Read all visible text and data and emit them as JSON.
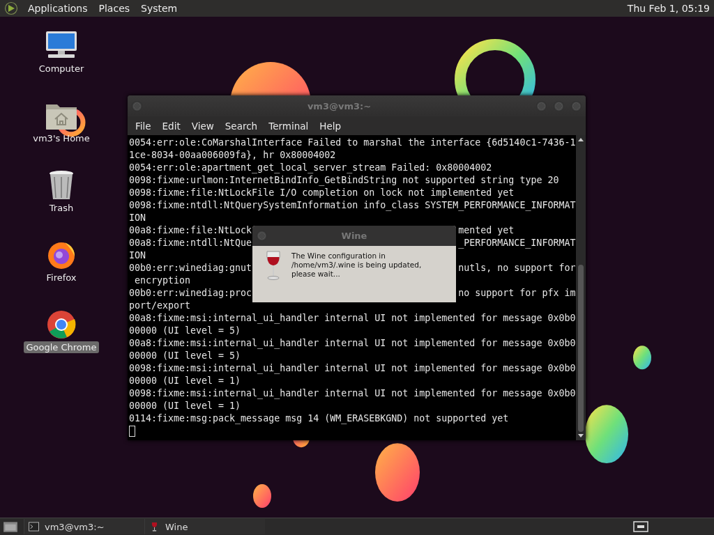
{
  "top_panel": {
    "menus": [
      "Applications",
      "Places",
      "System"
    ],
    "clock": "Thu Feb  1, 05:19"
  },
  "desktop_icons": [
    {
      "kind": "computer",
      "label": "Computer",
      "selected": false
    },
    {
      "kind": "home",
      "label": "vm3's Home",
      "selected": false
    },
    {
      "kind": "trash",
      "label": "Trash",
      "selected": false
    },
    {
      "kind": "firefox",
      "label": "Firefox",
      "selected": false
    },
    {
      "kind": "chrome",
      "label": "Google Chrome",
      "selected": true
    }
  ],
  "terminal": {
    "title": "vm3@vm3:~",
    "menus": [
      "File",
      "Edit",
      "View",
      "Search",
      "Terminal",
      "Help"
    ],
    "rows": [
      {
        "text": "0054:err:ole:CoMarshalInterface Failed to marshal the interface {6d5140c1-7436-1"
      },
      {
        "text": "1ce-8034-00aa006009fa}, hr 0x80004002"
      },
      {
        "text": "0054:err:ole:apartment_get_local_server_stream Failed: 0x80004002"
      },
      {
        "text": "0098:fixme:urlmon:InternetBindInfo_GetBindString not supported string type 20"
      },
      {
        "text": "0098:fixme:file:NtLockFile I/O completion on lock not implemented yet"
      },
      {
        "text": "0098:fixme:ntdll:NtQuerySystemInformation info_class SYSTEM_PERFORMANCE_INFORMAT"
      },
      {
        "text": "ION"
      },
      {
        "text": "00a8:fixme:file:NtLock",
        "right": "mented yet"
      },
      {
        "text": "00a8:fixme:ntdll:NtQue",
        "right": "_PERFORMANCE_INFORMAT"
      },
      {
        "text": "ION"
      },
      {
        "text": "00b0:err:winediag:gnut",
        "right": "nutls, no support for"
      },
      {
        "text": " encryption"
      },
      {
        "text": "00b0:err:winediag:proc",
        "right": "no support for pfx im"
      },
      {
        "text": "port/export"
      },
      {
        "text": "00a8:fixme:msi:internal_ui_handler internal UI not implemented for message 0x0b0"
      },
      {
        "text": "00000 (UI level = 5)"
      },
      {
        "text": "00a8:fixme:msi:internal_ui_handler internal UI not implemented for message 0x0b0"
      },
      {
        "text": "00000 (UI level = 5)"
      },
      {
        "text": "0098:fixme:msi:internal_ui_handler internal UI not implemented for message 0x0b0"
      },
      {
        "text": "00000 (UI level = 1)"
      },
      {
        "text": "0098:fixme:msi:internal_ui_handler internal UI not implemented for message 0x0b0"
      },
      {
        "text": "00000 (UI level = 1)"
      },
      {
        "text": "0114:fixme:msg:pack_message msg 14 (WM_ERASEBKGND) not supported yet"
      }
    ]
  },
  "dialog": {
    "title": "Wine",
    "message": "The Wine configuration in /home/vm3/.wine is being updated, please wait..."
  },
  "taskbar": {
    "tasks": [
      {
        "kind": "terminal",
        "label": "vm3@vm3:~"
      },
      {
        "kind": "wine",
        "label": "Wine"
      }
    ]
  }
}
